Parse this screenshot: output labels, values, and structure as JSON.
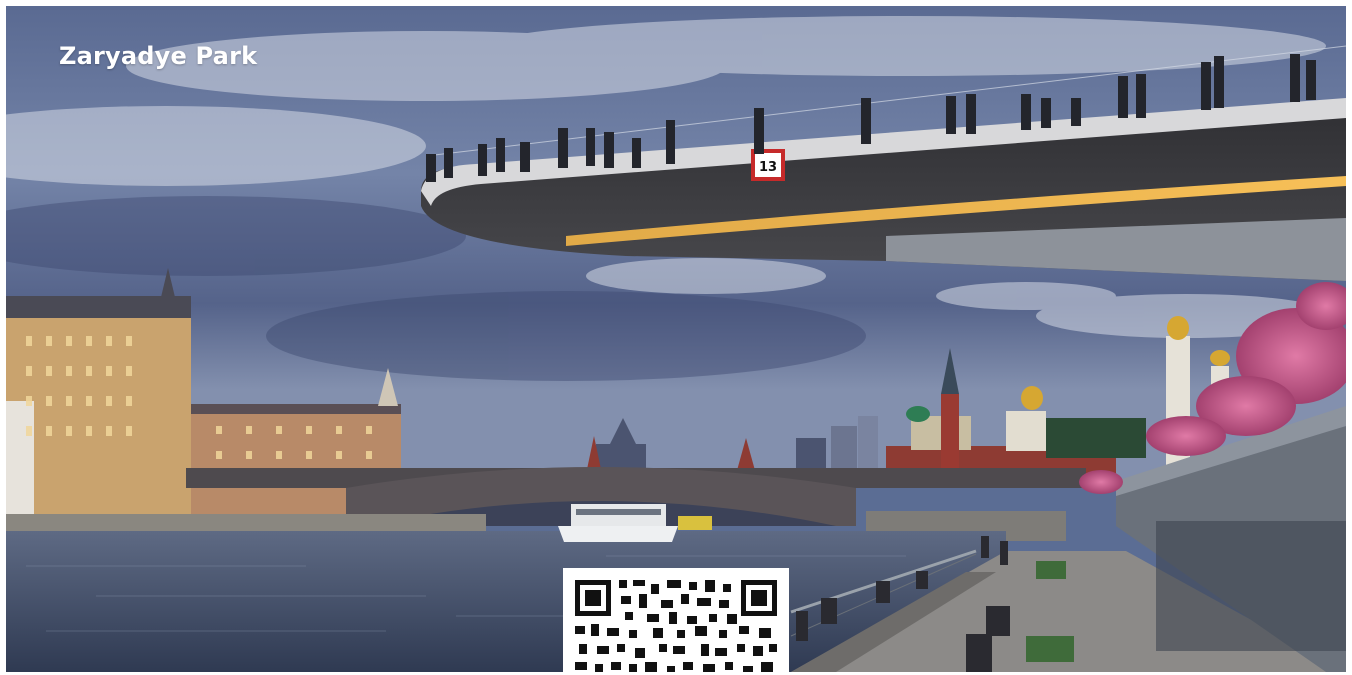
{
  "caption": {
    "title": "Zaryadye Park"
  },
  "pier_sign": {
    "number": "13"
  },
  "colors": {
    "sky_top": "#3f5482",
    "sky_mid": "#6b7ea3",
    "cloud": "#c9d0de",
    "river": "#3c4a63",
    "deck_underside": "#3a3a3c",
    "deck_light": "#f5a623",
    "blossom": "#c25a8a",
    "kremlin_wall": "#9a3a32",
    "gold_dome": "#d6a732"
  },
  "icons": {
    "qr": "qr-code-icon"
  }
}
